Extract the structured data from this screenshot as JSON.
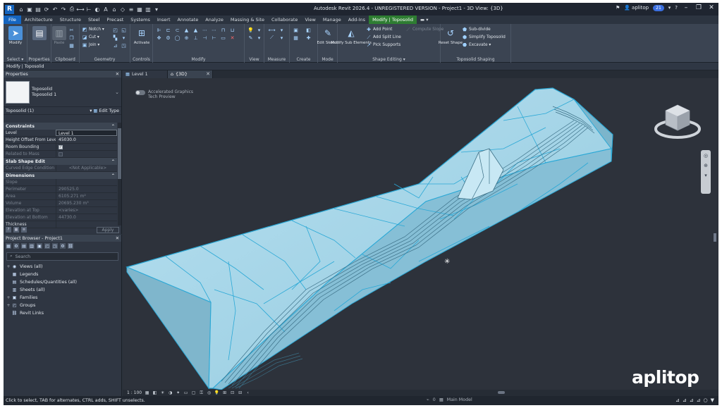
{
  "window": {
    "title": "Autodesk Revit 2026.4 - UNREGISTERED VERSION - Project1 - 3D View: {3D}",
    "user": "aplitop",
    "badge": "21"
  },
  "ribbon_tabs": [
    "File",
    "Architecture",
    "Structure",
    "Steel",
    "Precast",
    "Systems",
    "Insert",
    "Annotate",
    "Analyze",
    "Massing & Site",
    "Collaborate",
    "View",
    "Manage",
    "Add-Ins",
    "Modify | Toposolid"
  ],
  "ribbon": {
    "select": {
      "label": "Modify",
      "group": "Select ▾"
    },
    "properties": {
      "group": "Properties"
    },
    "clipboard": {
      "paste": "Paste",
      "group": "Clipboard"
    },
    "geometry": {
      "notch": "Notch ▾",
      "cut": "Cut ▾",
      "join": "Join ▾",
      "group": "Geometry"
    },
    "controls": {
      "activate": "Activate",
      "group": "Controls"
    },
    "modify": {
      "group": "Modify"
    },
    "view": {
      "group": "View"
    },
    "measure": {
      "group": "Measure"
    },
    "create": {
      "group": "Create"
    },
    "mode": {
      "edit_sketch": "Edit Sketch",
      "group": "Mode"
    },
    "shape_editing": {
      "modify_sub": "Modify Sub Elements",
      "add_point": "Add Point",
      "add_split_line": "Add Split Line",
      "pick_supports": "Pick Supports",
      "compute_slope": "Compute Slope",
      "reset_shape": "Reset Shape",
      "group": "Shape Editing ▾"
    },
    "toposolid_shaping": {
      "sub_divide": "Sub-divide",
      "simplify": "Simplify Toposolid",
      "excavate": "Excavate ▾",
      "group": "Toposolid Shaping"
    }
  },
  "context_bar": "Modify | Toposolid",
  "properties": {
    "title": "Properties",
    "type_family": "Toposolid",
    "type_name": "Toposolid 1",
    "instance": "Toposolid (1)",
    "edit_type": "Edit Type",
    "sections": {
      "constraints": "Constraints",
      "slab_shape": "Slab Shape Edit",
      "dimensions": "Dimensions"
    },
    "rows": {
      "level_k": "Level",
      "level_v": "Level 1",
      "offset_k": "Height Offset From Level",
      "offset_v": "45030.0",
      "room_k": "Room Bounding",
      "related_k": "Related to Mass",
      "curved_k": "Curved Edge Condition",
      "curved_v": "<Not Applicable>",
      "slope_k": "Slope",
      "perimeter_k": "Perimeter",
      "perimeter_v": "290525.0",
      "area_k": "Area",
      "area_v": "6105.271 m²",
      "volume_k": "Volume",
      "volume_v": "20695.230 m³",
      "elev_top_k": "Elevation at Top",
      "elev_top_v": "<varies>",
      "elev_bot_k": "Elevation at Bottom",
      "elev_bot_v": "44730.0",
      "thickness_k": "Thickness"
    },
    "apply": "Apply"
  },
  "browser": {
    "title": "Project Browser - Project1",
    "search_placeholder": "Search",
    "items": [
      {
        "label": "Views (all)"
      },
      {
        "label": "Legends"
      },
      {
        "label": "Schedules/Quantities (all)"
      },
      {
        "label": "Sheets (all)"
      },
      {
        "label": "Families"
      },
      {
        "label": "Groups"
      },
      {
        "label": "Revit Links"
      }
    ]
  },
  "view_tabs": [
    {
      "label": "Level 1"
    },
    {
      "label": "{3D}"
    }
  ],
  "canvas": {
    "accel_line1": "Accelerated Graphics",
    "accel_line2": "Tech Preview",
    "watermark": "aplitop"
  },
  "view_control": {
    "scale": "1 : 100"
  },
  "statusbar": {
    "message": "Click to select, TAB for alternates, CTRL adds, SHIFT unselects.",
    "zero": "0",
    "model": "Main Model"
  },
  "colors": {
    "terrain_fill": "#a8d6ea",
    "terrain_edge": "#2aa8d6",
    "file_tab": "#1565c0",
    "context_tab": "#2e7d32"
  }
}
